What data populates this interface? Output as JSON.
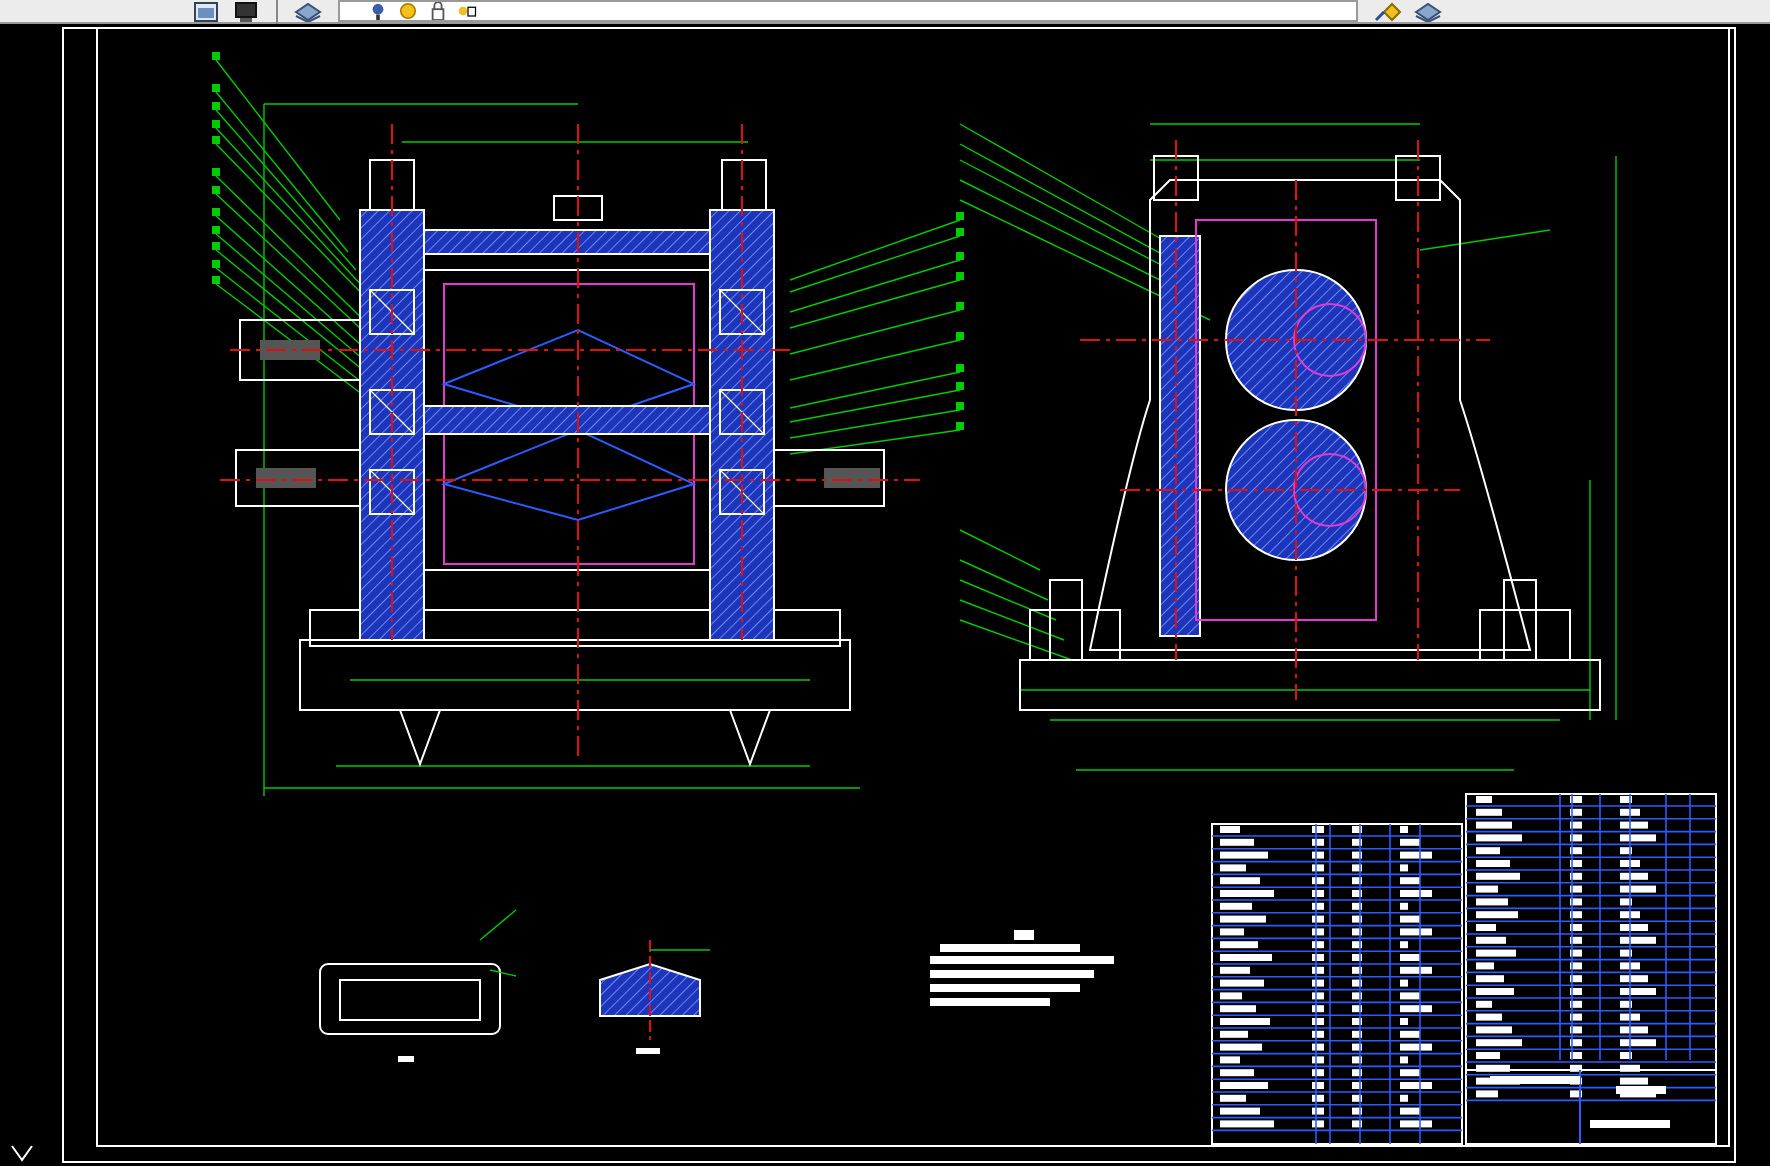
{
  "toolbar": {
    "left_icons": [
      {
        "kind": "window"
      },
      {
        "kind": "monitor"
      }
    ],
    "layer_icons": [
      {
        "kind": "layers"
      }
    ],
    "layer_field_icons": [
      {
        "kind": "bulb"
      },
      {
        "kind": "sun"
      },
      {
        "kind": "lock"
      },
      {
        "kind": "swatch"
      }
    ],
    "right_icons": [
      {
        "kind": "match"
      },
      {
        "kind": "layers"
      }
    ]
  },
  "sheet": {
    "views": [
      {
        "kind": "front"
      },
      {
        "kind": "side"
      },
      {
        "kind": "detail-plate"
      },
      {
        "kind": "detail-section"
      },
      {
        "kind": "notes"
      },
      {
        "kind": "parts-table"
      }
    ]
  }
}
